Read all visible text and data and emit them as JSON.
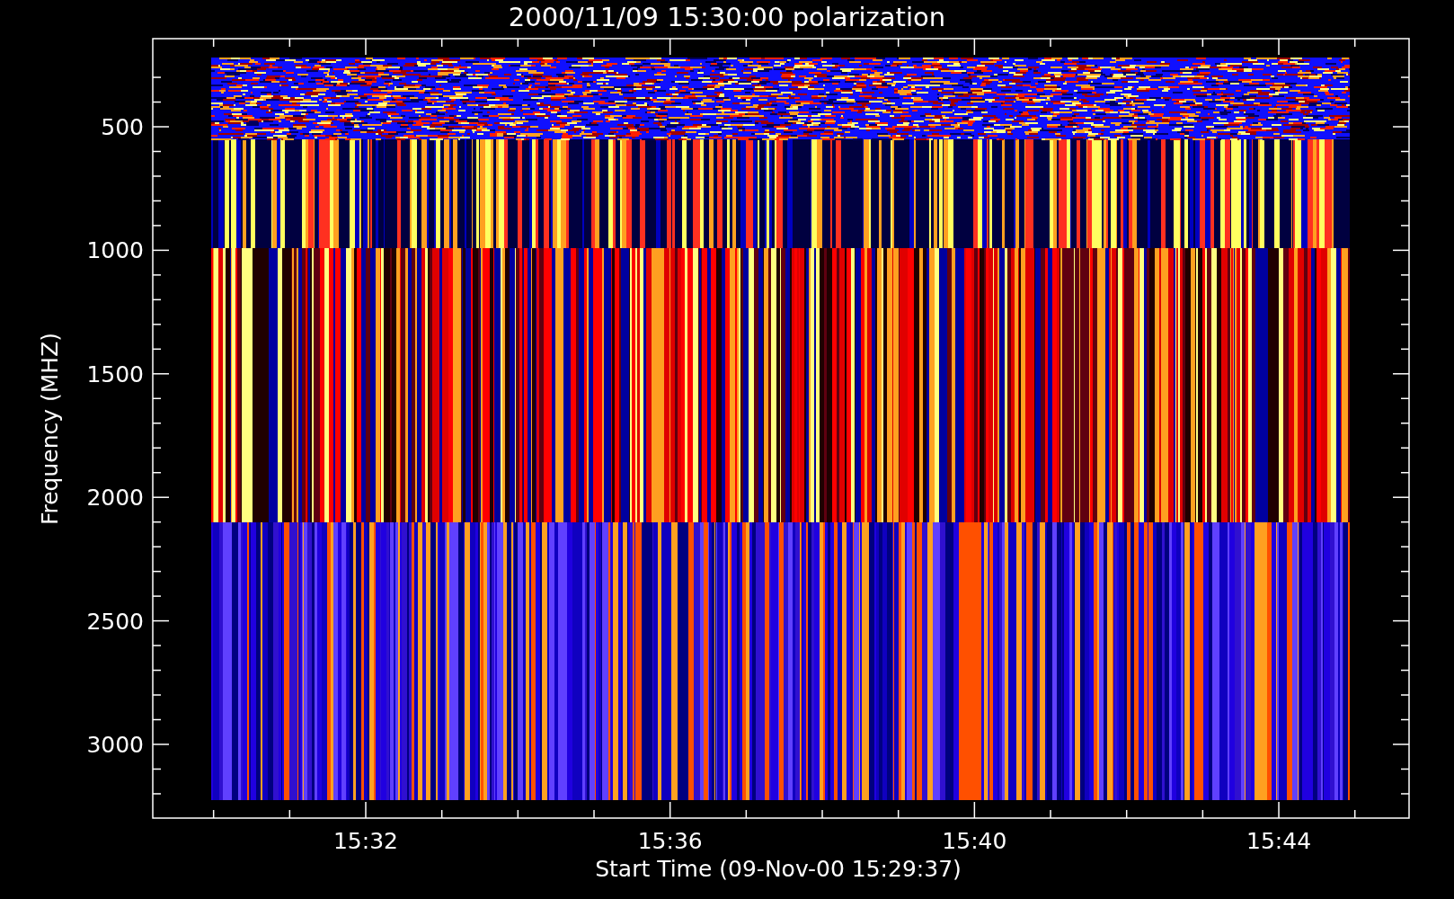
{
  "title": "2000/11/09 15:30:00 polarization",
  "y_axis": {
    "label": "Frequency (MHZ)",
    "ticks": [
      "500",
      "1000",
      "1500",
      "2000",
      "2500",
      "3000"
    ]
  },
  "x_axis": {
    "label": "Start Time (09-Nov-00 15:29:37)",
    "ticks": [
      "15:32",
      "15:36",
      "15:40",
      "15:44"
    ]
  }
}
